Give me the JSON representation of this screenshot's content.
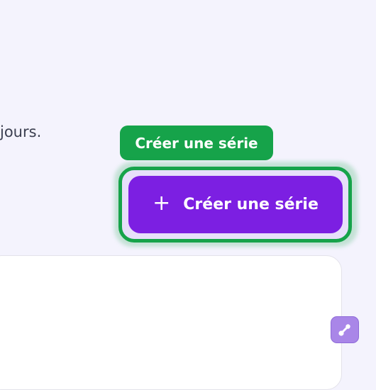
{
  "intro": {
    "text_fragment": "jours."
  },
  "tooltip": {
    "label": "Créer une série"
  },
  "create_series_button": {
    "icon": "plus-icon",
    "label": "Créer une série"
  },
  "link_widget": {
    "icon": "link-icon"
  },
  "colors": {
    "page_background": "#f4f3fd",
    "highlight_green": "#16a34a",
    "button_purple": "#7c1fe2",
    "widget_purple": "#a986e8"
  }
}
